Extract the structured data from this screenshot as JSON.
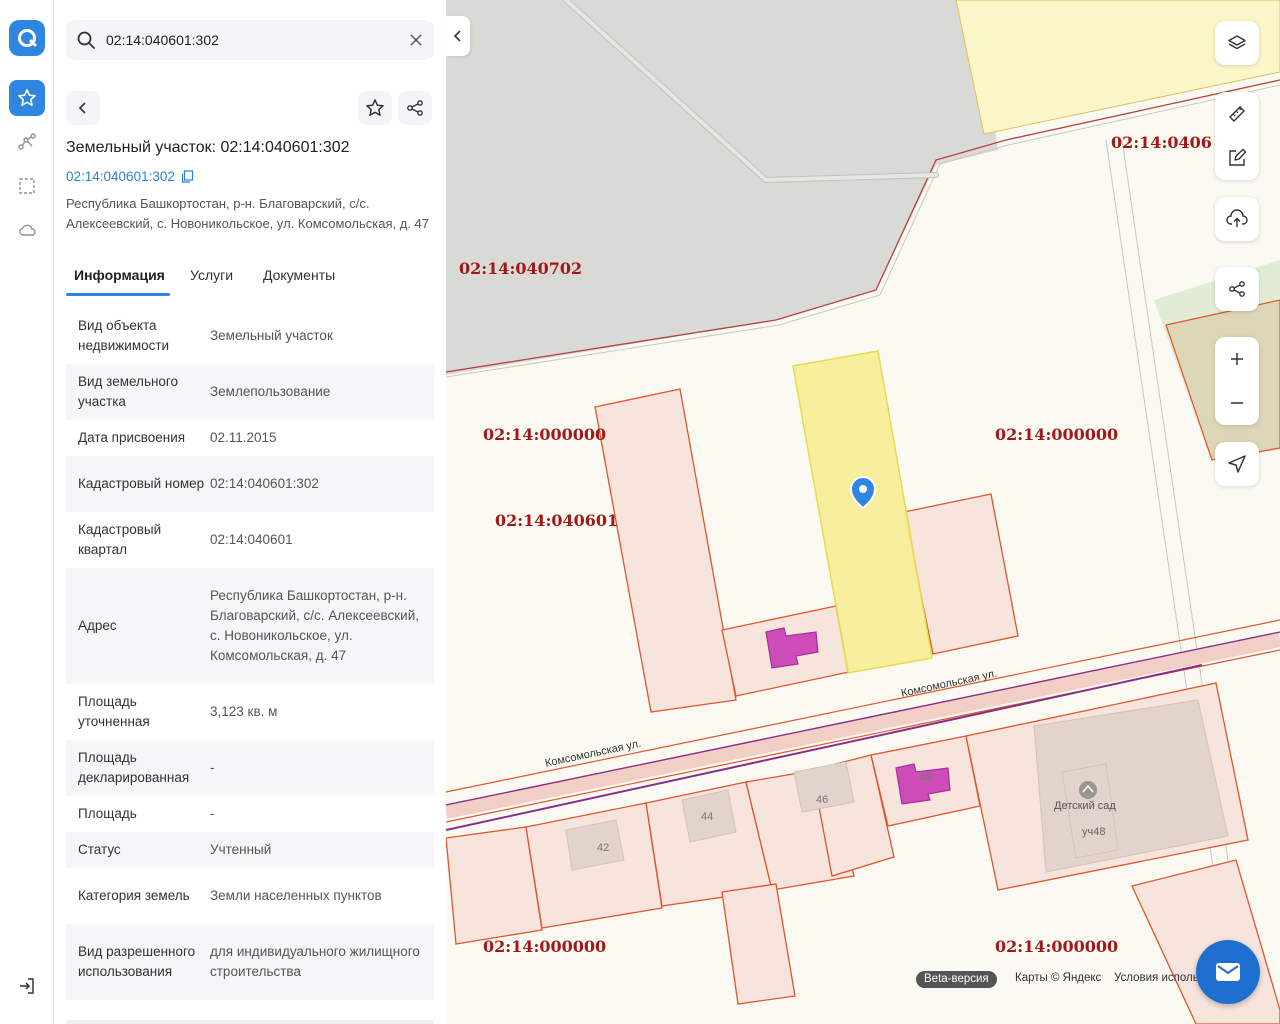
{
  "search": {
    "value": "02:14:040601:302"
  },
  "parcel": {
    "title": "Земельный участок: 02:14:040601:302",
    "cad_number": "02:14:040601:302",
    "address": "Республика Башкортостан, р-н. Благоварский, с/с. Алексеевский, с. Новоникольское, ул. Комсомольская, д. 47"
  },
  "tabs": [
    "Информация",
    "Услуги",
    "Документы"
  ],
  "info": [
    {
      "k": "Вид объекта недвижимости",
      "v": "Земельный участок"
    },
    {
      "k": "Вид земельного участка",
      "v": "Землепользование"
    },
    {
      "k": "Дата присвоения",
      "v": "02.11.2015"
    },
    {
      "k": "Кадастровый номер",
      "v": "02:14:040601:302"
    },
    {
      "k": "Кадастровый квартал",
      "v": "02:14:040601"
    },
    {
      "k": "Адрес",
      "v": "Республика Башкортостан, р-н. Благоварский, с/с. Алексеевский, с. Новоникольское, ул. Комсомольская, д. 47"
    },
    {
      "k": "Площадь уточненная",
      "v": "3,123 кв. м"
    },
    {
      "k": "Площадь декларированная",
      "v": "-"
    },
    {
      "k": "Площадь",
      "v": "-"
    },
    {
      "k": "Статус",
      "v": "Учтенный"
    },
    {
      "k": "Категория земель",
      "v": "Земли населенных пунктов"
    },
    {
      "k": "Вид разрешенного использования",
      "v": "для индивидуального жилищного строительства"
    }
  ],
  "map": {
    "labels": {
      "q_040702": "02:14:040702",
      "q_040601": "02:14:040601",
      "q_0406_top": "02:14:0406",
      "q_000_a": "02:14:000000",
      "q_000_b": "02:14:000000",
      "q_000_c": "02:14:000000",
      "q_000_d": "02:14:000000"
    },
    "street_1": "Комсомольская ул.",
    "street_2": "Комсомольская ул.",
    "houses": [
      "42",
      "44",
      "46",
      "48"
    ],
    "kindergarten": "Детский сад",
    "plot_48": "уч48",
    "beta": "Beta-версия",
    "attribution": "Карты © Яндекс",
    "terms": "Условия исполь"
  },
  "colors": {
    "accent": "#2f86e0",
    "parcel_selected": "#f7ef9a",
    "parcel_outline": "#e0552e",
    "quarter_label": "#a01818",
    "building_magenta": "#c63db0"
  },
  "icons": {
    "logo": "app-logo-icon",
    "rail": [
      "star-icon",
      "route-icon",
      "select-area-icon",
      "cloud-icon",
      "logout-icon"
    ],
    "map_controls": [
      "layers-icon",
      "ruler-icon",
      "edit-icon",
      "upload-icon",
      "share-icon",
      "zoom-in-icon",
      "zoom-out-icon",
      "locate-icon"
    ]
  }
}
